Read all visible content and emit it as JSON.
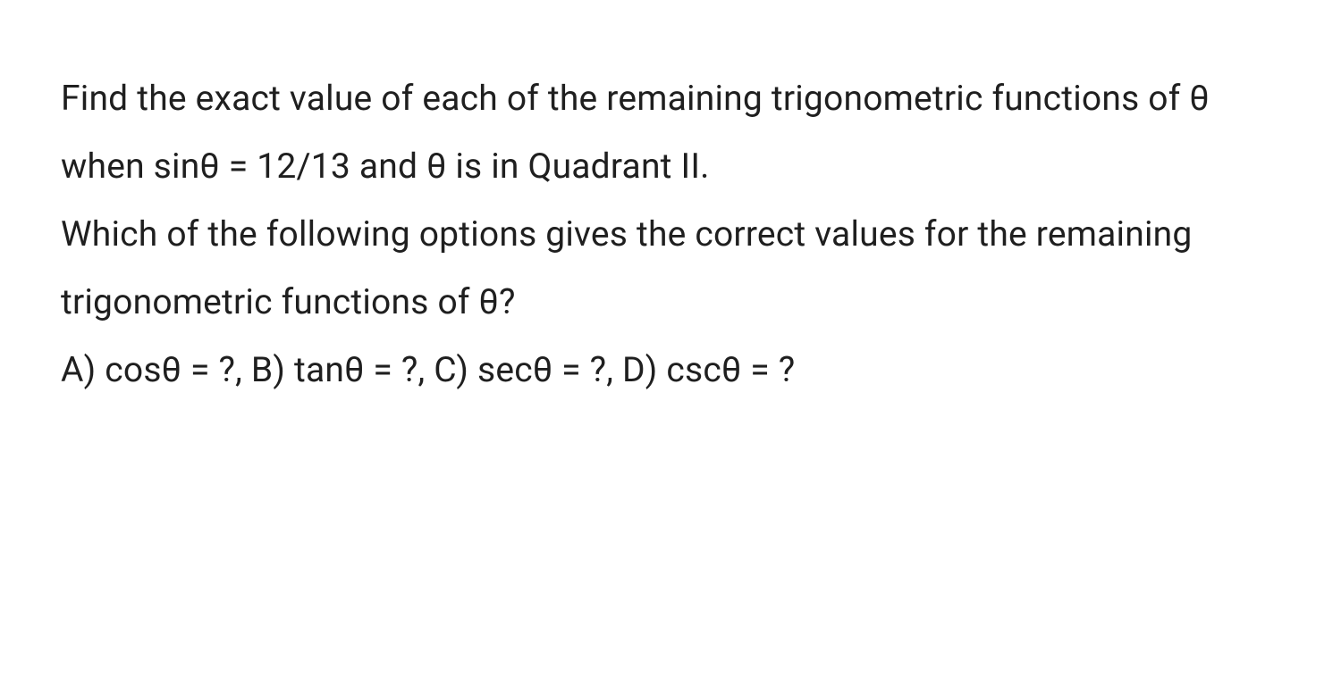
{
  "problem": {
    "line1": "Find the exact value of each of the remaining trigonometric functions of θ when sinθ = 12/13 and θ is in Quadrant II.",
    "line2": "Which of the following options gives the correct values for the remaining trigonometric functions of θ?",
    "line3": "A) cosθ = ?, B) tanθ = ?, C) secθ = ?, D) cscθ = ?"
  }
}
